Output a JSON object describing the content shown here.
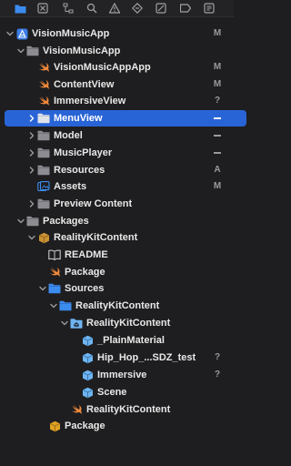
{
  "colors": {
    "background": "#1e1e20",
    "selection": "#2964d6",
    "folder": "#8c8c92",
    "swift": "#f0883a",
    "accent_blue": "#3c8cf0",
    "package": "#e0a224",
    "entity": "#6fb4f0"
  },
  "toolbar": {
    "icons": [
      {
        "name": "folder-icon",
        "active": true
      },
      {
        "name": "close-square-icon",
        "active": false
      },
      {
        "name": "hierarchy-icon",
        "active": false
      },
      {
        "name": "search-icon",
        "active": false
      },
      {
        "name": "warning-icon",
        "active": false
      },
      {
        "name": "diamond-icon",
        "active": false
      },
      {
        "name": "tag-icon",
        "active": false
      },
      {
        "name": "breakpoint-icon",
        "active": false
      },
      {
        "name": "report-icon",
        "active": false
      }
    ]
  },
  "tree": [
    {
      "label": "VisionMusicApp",
      "icon": "project-icon",
      "expanded": true,
      "badge": "M"
    },
    {
      "label": "VisionMusicApp",
      "icon": "folder-icon",
      "expanded": true,
      "badge": ""
    },
    {
      "label": "VisionMusicAppApp",
      "icon": "swift-icon",
      "badge": "M"
    },
    {
      "label": "ContentView",
      "icon": "swift-icon",
      "badge": "M"
    },
    {
      "label": "ImmersiveView",
      "icon": "swift-icon",
      "badge": "?"
    },
    {
      "label": "MenuView",
      "icon": "folder-icon",
      "expanded": false,
      "badge": "—",
      "selected": true
    },
    {
      "label": "Model",
      "icon": "folder-icon",
      "expanded": false,
      "badge": "—"
    },
    {
      "label": "MusicPlayer",
      "icon": "folder-icon",
      "expanded": false,
      "badge": "—"
    },
    {
      "label": "Resources",
      "icon": "folder-icon",
      "expanded": false,
      "badge": "A"
    },
    {
      "label": "Assets",
      "icon": "assets-icon",
      "badge": "M"
    },
    {
      "label": "Preview Content",
      "icon": "folder-icon",
      "expanded": false,
      "badge": ""
    },
    {
      "label": "Packages",
      "icon": "folder-icon",
      "expanded": true,
      "badge": ""
    },
    {
      "label": "RealityKitContent",
      "icon": "package-box-icon",
      "expanded": true,
      "badge": ""
    },
    {
      "label": "README",
      "icon": "book-icon",
      "badge": ""
    },
    {
      "label": "Package",
      "icon": "swift-icon",
      "badge": ""
    },
    {
      "label": "Sources",
      "icon": "folder-blue-icon",
      "expanded": true,
      "badge": ""
    },
    {
      "label": "RealityKitContent",
      "icon": "folder-blue-icon",
      "expanded": true,
      "badge": ""
    },
    {
      "label": "RealityKitContent",
      "icon": "rkassets-icon",
      "expanded": true,
      "badge": ""
    },
    {
      "label": "_PlainMaterial",
      "icon": "entity-icon",
      "badge": ""
    },
    {
      "label": "Hip_Hop_...SDZ_test",
      "icon": "entity-icon",
      "badge": "?"
    },
    {
      "label": "Immersive",
      "icon": "entity-icon",
      "badge": "?"
    },
    {
      "label": "Scene",
      "icon": "entity-icon",
      "badge": ""
    },
    {
      "label": "RealityKitContent",
      "icon": "swift-icon",
      "badge": ""
    },
    {
      "label": "Package",
      "icon": "package-icon",
      "badge": ""
    }
  ]
}
